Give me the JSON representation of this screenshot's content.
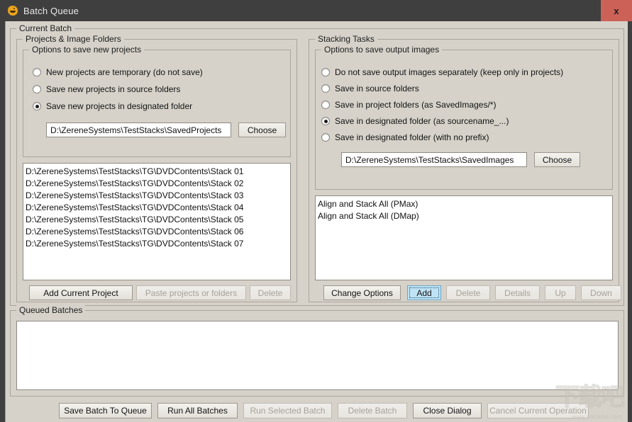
{
  "window": {
    "title": "Batch Queue",
    "icon": "app-icon",
    "close_label": "x",
    "accent_close_color": "#cb6157",
    "titlebar_color": "#3f3f3f",
    "client_color": "#d6d2ca"
  },
  "current_batch": {
    "title": "Current Batch",
    "projects_group": {
      "title": "Projects & Image Folders",
      "options_group": {
        "title": "Options to save new projects",
        "radios": [
          {
            "label": "New projects are temporary (do not save)",
            "checked": false
          },
          {
            "label": "Save new projects in source folders",
            "checked": false
          },
          {
            "label": "Save new projects in designated folder",
            "checked": true
          }
        ],
        "path_field": {
          "value": "D:\\ZereneSystems\\TestStacks\\SavedProjects",
          "placeholder": ""
        },
        "choose_label": "Choose"
      },
      "list_items": [
        "D:\\ZereneSystems\\TestStacks\\TG\\DVDContents\\Stack 01",
        "D:\\ZereneSystems\\TestStacks\\TG\\DVDContents\\Stack 02",
        "D:\\ZereneSystems\\TestStacks\\TG\\DVDContents\\Stack 03",
        "D:\\ZereneSystems\\TestStacks\\TG\\DVDContents\\Stack 04",
        "D:\\ZereneSystems\\TestStacks\\TG\\DVDContents\\Stack 05",
        "D:\\ZereneSystems\\TestStacks\\TG\\DVDContents\\Stack 06",
        "D:\\ZereneSystems\\TestStacks\\TG\\DVDContents\\Stack 07"
      ],
      "buttons": [
        {
          "label": "Add Current Project",
          "enabled": true,
          "focused": false
        },
        {
          "label": "Paste projects or folders",
          "enabled": false,
          "focused": false
        },
        {
          "label": "Delete",
          "enabled": false,
          "focused": false
        }
      ]
    },
    "stacking_group": {
      "title": "Stacking Tasks",
      "options_group": {
        "title": "Options to save output images",
        "radios": [
          {
            "label": "Do not save output images separately (keep only in projects)",
            "checked": false
          },
          {
            "label": "Save in source folders",
            "checked": false
          },
          {
            "label": "Save in project folders (as SavedImages/*)",
            "checked": false
          },
          {
            "label": "Save in designated folder (as sourcename_...)",
            "checked": true
          },
          {
            "label": "Save in designated folder (with no prefix)",
            "checked": false
          }
        ],
        "path_field": {
          "value": "D:\\ZereneSystems\\TestStacks\\SavedImages",
          "placeholder": ""
        },
        "choose_label": "Choose"
      },
      "list_items": [
        "Align and Stack All (PMax)",
        "Align and Stack All (DMap)"
      ],
      "buttons": [
        {
          "label": "Change Options",
          "enabled": true,
          "focused": false
        },
        {
          "label": "Add",
          "enabled": true,
          "focused": true
        },
        {
          "label": "Delete",
          "enabled": false,
          "focused": false
        },
        {
          "label": "Details",
          "enabled": false,
          "focused": false
        },
        {
          "label": "Up",
          "enabled": false,
          "focused": false
        },
        {
          "label": "Down",
          "enabled": false,
          "focused": false
        }
      ]
    }
  },
  "queued_batches": {
    "title": "Queued Batches",
    "items": []
  },
  "bottom_buttons": [
    {
      "label": "Save Batch To Queue",
      "enabled": true
    },
    {
      "label": "Run All Batches",
      "enabled": true
    },
    {
      "label": "Run Selected Batch",
      "enabled": false
    },
    {
      "label": "Delete Batch",
      "enabled": false
    },
    {
      "label": "Close Dialog",
      "enabled": true
    },
    {
      "label": "Cancel Current Operation",
      "enabled": false
    }
  ],
  "watermark": {
    "cn": "下载吧",
    "url": "www.xiazaiba.com"
  }
}
